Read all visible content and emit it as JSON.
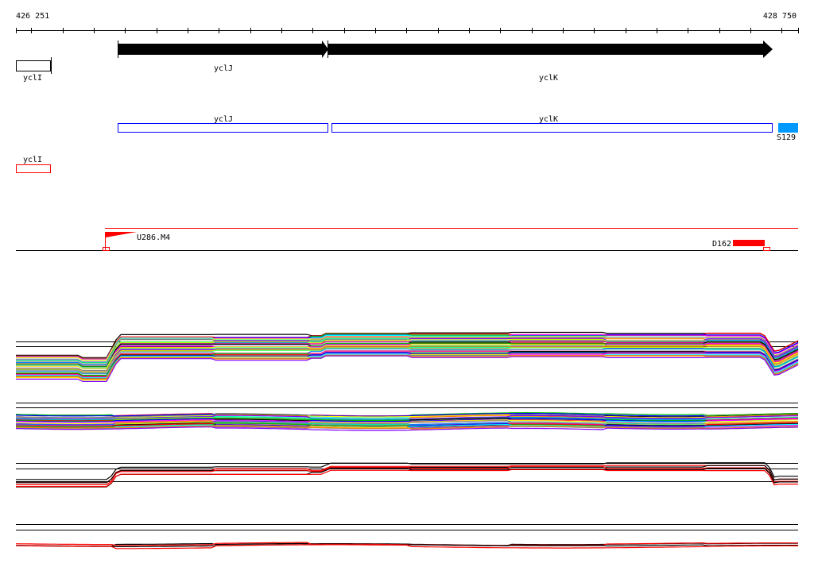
{
  "ruler": {
    "start_label": "426 251",
    "end_label": "428 750"
  },
  "genes_track": {
    "genes": [
      {
        "name": "yclI",
        "style": "outline-box"
      },
      {
        "name": "yclJ",
        "style": "arrow"
      },
      {
        "name": "yclK",
        "style": "arrow"
      }
    ]
  },
  "transcripts_track": {
    "items": [
      {
        "name": "yclJ",
        "color": "#0000ff"
      },
      {
        "name": "yclK",
        "color": "#0000ff"
      },
      {
        "name": "S129",
        "color": "#0099ff"
      }
    ]
  },
  "red_track": {
    "items": [
      {
        "name": "yclI",
        "color": "#ff0000"
      }
    ]
  },
  "markers_track": {
    "left_marker": "U286.M4",
    "right_marker": "D162",
    "color": "#ff0000"
  },
  "colors": {
    "palette": [
      "#ff0000",
      "#00c000",
      "#0000ff",
      "#ff00ff",
      "#00ffff",
      "#ffff00",
      "#808080",
      "#ff8000",
      "#8000ff",
      "#00ff80",
      "#c0ff00",
      "#0080ff",
      "#a0a0a0",
      "#ff0080"
    ]
  }
}
